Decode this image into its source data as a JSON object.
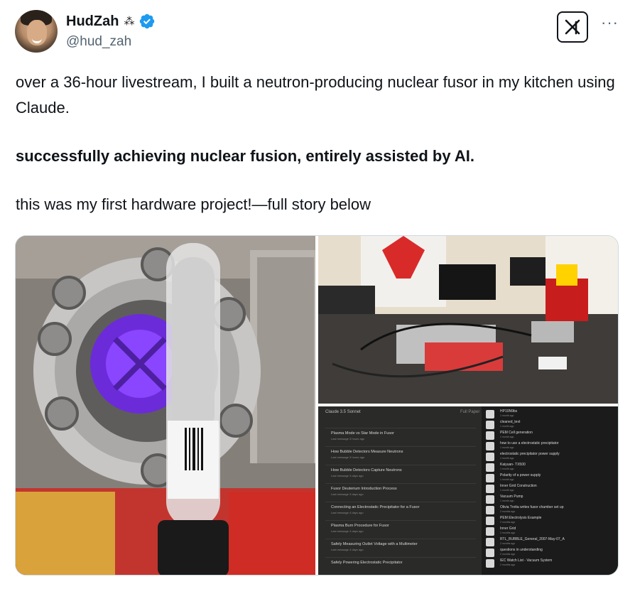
{
  "user": {
    "display_name": "HudZah",
    "name_emoji": "⁂",
    "handle": "@hud_zah",
    "verified_color": "#1d9bf0"
  },
  "actions": {
    "grok_icon": "grok-icon",
    "more_label": "···"
  },
  "tweet": {
    "line_1": "over a 36-hour livestream, I built a neutron-producing nuclear fusor in my kitchen using Claude.",
    "line_2": "successfully achieving nuclear fusion, entirely assisted by AI.",
    "line_3": "this was my first hardware project!—full story below"
  },
  "media": {
    "screenshot_header": "Claude 3.5 Sonnet",
    "screenshot_header_right": "Full Paper",
    "chat_items": [
      {
        "title": "Plasma Mode vs Star Mode in Fusor",
        "sub": "Last message 3 hours ago"
      },
      {
        "title": "How Bubble Detectors Measure Neutrons",
        "sub": "Last message 3 hours ago"
      },
      {
        "title": "How Bubble Detectors Capture Neutrons",
        "sub": "Last message 3 days ago"
      },
      {
        "title": "Fusor Deuterium Introduction Process",
        "sub": "Last message 3 days ago"
      },
      {
        "title": "Connecting an Electrostatic Precipitator for a Fusor",
        "sub": "Last message 4 days ago"
      },
      {
        "title": "Plasma Burn Procedure for Fusor",
        "sub": "Last message 4 days ago"
      },
      {
        "title": "Safely Measuring Outlet Voltage with a Multimeter",
        "sub": "Last message 4 days ago"
      },
      {
        "title": "Safely Powering Electrostatic Precipitator",
        "sub": ""
      }
    ],
    "file_items": [
      {
        "title": "HP10N9bs",
        "sub": "1 month ago"
      },
      {
        "title": "cleaned_text",
        "sub": "1 month ago"
      },
      {
        "title": "PEM Cell generation",
        "sub": "1 month ago"
      },
      {
        "title": "how to use a electrostatic precipitator",
        "sub": "1 month ago"
      },
      {
        "title": "electrostatic precipitator power supply",
        "sub": "1 month ago"
      },
      {
        "title": "Kaiyuan- TX500",
        "sub": "1 month ago"
      },
      {
        "title": "Polarity of a power supply",
        "sub": "1 month ago"
      },
      {
        "title": "Inner Grid Construction",
        "sub": "1 month ago"
      },
      {
        "title": "Vacuum Pump",
        "sub": "1 month ago"
      },
      {
        "title": "Olivia Trotta writes fusor chamber set up",
        "sub": "2 months ago"
      },
      {
        "title": "PEM Electrolysis Example",
        "sub": "2 months ago"
      },
      {
        "title": "Inner Grid",
        "sub": "2 months ago"
      },
      {
        "title": "RTL_BUBBLE_General_2007-May-07_A",
        "sub": "2 months ago"
      },
      {
        "title": "questions in understanding",
        "sub": "2 months ago"
      },
      {
        "title": "IEC Watch List - Vacuum System",
        "sub": "2 months ago"
      }
    ]
  }
}
